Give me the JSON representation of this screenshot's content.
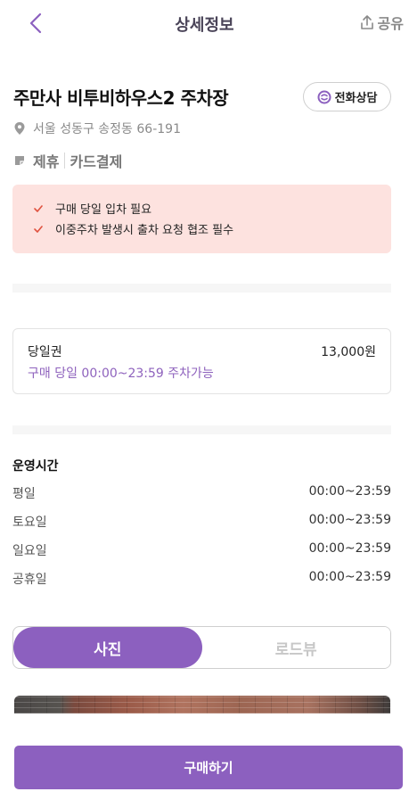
{
  "header": {
    "title": "상세정보",
    "share_label": "공유"
  },
  "lot": {
    "name": "주만사 비투비하우스2 주차장",
    "call_label": "전화상담",
    "address": "서울 성동구 송정동 66-191",
    "tags": [
      "제휴",
      "카드결제"
    ]
  },
  "notice": {
    "items": [
      "구매 당일 입차 필요",
      "이중주차 발생시 출차 요청 협조 필수"
    ],
    "check_color": "#e0523f"
  },
  "ticket": {
    "name": "당일권",
    "price": "13,000원",
    "description": "구매 당일 00:00~23:59 주차가능"
  },
  "hours": {
    "title": "운영시간",
    "rows": [
      {
        "day": "평일",
        "time": "00:00~23:59"
      },
      {
        "day": "토요일",
        "time": "00:00~23:59"
      },
      {
        "day": "일요일",
        "time": "00:00~23:59"
      },
      {
        "day": "공휴일",
        "time": "00:00~23:59"
      }
    ]
  },
  "tabs": {
    "photo_label": "사진",
    "roadview_label": "로드뷰",
    "active": "photo"
  },
  "purchase_label": "구매하기",
  "colors": {
    "accent": "#8c60bf",
    "notice_bg": "#fde2df",
    "header_title": "#4a4458"
  },
  "icons": {
    "back": "chevron-left-icon",
    "share": "share-upload-icon",
    "call": "phone-consult-icon",
    "location": "map-pin-icon",
    "tag": "tag-icon",
    "check": "check-icon"
  }
}
